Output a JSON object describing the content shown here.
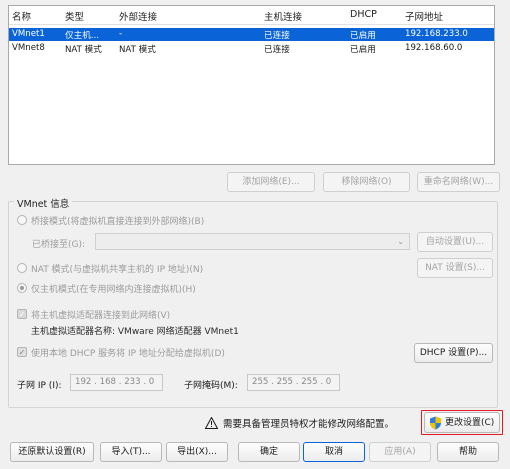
{
  "table": {
    "headers": [
      "名称",
      "类型",
      "外部连接",
      "主机连接",
      "DHCP",
      "子网地址"
    ],
    "rows": [
      [
        "VMnet1",
        "仅主机...",
        "-",
        "已连接",
        "已启用",
        "192.168.233.0"
      ],
      [
        "VMnet8",
        "NAT 模式",
        "NAT 模式",
        "已连接",
        "已启用",
        "192.168.60.0"
      ]
    ],
    "selected_row": 0
  },
  "table_buttons": {
    "add": "添加网络(E)...",
    "remove": "移除网络(O)",
    "rename": "重命名网络(W)..."
  },
  "group": {
    "title": "VMnet 信息",
    "bridged_label": "桥接模式(将虚拟机直接连接到外部网络)(B)",
    "bridged_to_label": "已桥接至(G):",
    "auto_settings": "自动设置(U)...",
    "nat_label": "NAT 模式(与虚拟机共享主机的 IP 地址)(N)",
    "nat_settings": "NAT 设置(S)...",
    "hostonly_label": "仅主机模式(在专用网络内连接虚拟机)(H)",
    "connect_adapter_label": "将主机虚拟适配器连接到此网络(V)",
    "adapter_name_line": "主机虚拟适配器名称: VMware 网络适配器 VMnet1",
    "dhcp_label": "使用本地 DHCP 服务将 IP 地址分配给虚拟机(D)",
    "dhcp_settings": "DHCP 设置(P)...",
    "subnet_ip_label": "子网 IP (I):",
    "subnet_ip": "192 . 168 . 233 . 0",
    "subnet_mask_label": "子网掩码(M):",
    "subnet_mask": "255 . 255 . 255 . 0"
  },
  "notice": {
    "text": "需要具备管理员特权才能修改网络配置。",
    "change_settings": "更改设置(C)"
  },
  "footer": {
    "restore": "还原默认设置(R)",
    "import": "导入(T)...",
    "export": "导出(X)...",
    "ok": "确定",
    "cancel": "取消",
    "apply": "应用(A)",
    "help": "帮助"
  },
  "colors": {
    "selection": "#0a64d8",
    "highlight_box": "#e21b23",
    "warning": "#f2c200"
  },
  "icons": {
    "warning": "warning-icon",
    "shield": "uac-shield-icon",
    "combo_arrow": "chevron-down-icon"
  }
}
